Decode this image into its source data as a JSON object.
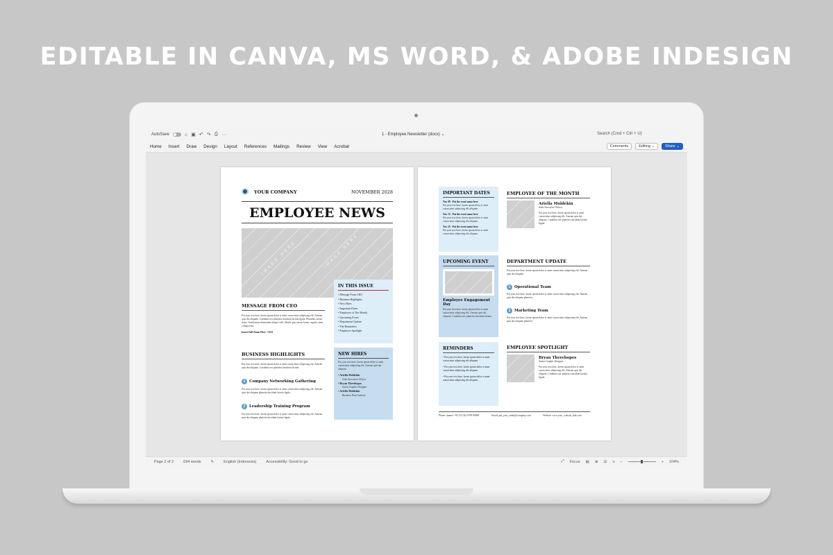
{
  "banner": "EDITABLE IN CANVA, MS WORD, & ADOBE INDESIGN",
  "titlebar": {
    "autosave": "AutoSave",
    "doc_title": "1 - Employee Newsletter (docx) ⌄",
    "search": "Search (Cmd + Ctrl + U)"
  },
  "ribbon": {
    "tabs": [
      "Home",
      "Insert",
      "Draw",
      "Design",
      "Layout",
      "References",
      "Mailings",
      "Review",
      "View",
      "Acrobat"
    ],
    "comments": "Comments",
    "editing": "Editing ⌄",
    "share": "Share ⌄"
  },
  "status": {
    "page": "Page 2 of 2",
    "words": "694 words",
    "language": "English (Indonesia)",
    "accessibility": "Accessibility: Good to go",
    "focus": "Focus",
    "zoom": "104%",
    "minus": "–",
    "plus": "+"
  },
  "page1": {
    "company": "YOUR COMPANY",
    "date": "NOVEMBER 2028",
    "headline": "EMPLOYEE NEWS",
    "image_placeholder": "IMAGE HERE",
    "ceo": {
      "title": "MESSAGE FROM CEO",
      "body": "Put your text here, lorem ipsum dolor si amet consectetur adipiscing elit. Aenean quis dui aliquam. Curabitur nec pharetra tincidunt lacinia ligula. Phasellus lorem dolor. Vestibulum elementum aliquet velit. Morbi quis cursus lorem, sagittis amet volutpat dui.",
      "sign": "Insert Full Name Here - CEO"
    },
    "issue": {
      "title": "IN THIS ISSUE",
      "items": [
        "Message From CEO",
        "Business Highlights",
        "New Hires",
        "Important Dates",
        "Employee of The Month",
        "Upcoming Event",
        "Department Update",
        "The Reminders",
        "Employee Spotlight"
      ]
    },
    "highlights": {
      "title": "BUSINESS HIGHLIGHTS",
      "intro": "Put your text here, lorem ipsum dolor si amet consectetur adipiscing elit. Aenean quis dui aliquam. Curabitur nec pharetra tincidunt lacinia.",
      "items": [
        {
          "num": "1",
          "title": "Company Networking Gathering",
          "body": "Put your text here, lorem ipsum dolor si amet consectetur adipiscing elit. Aenean quis dui aliquam pharetra tincidunt lacinia ligula."
        },
        {
          "num": "2",
          "title": "Leadership Training Program",
          "body": "Put your text here, lorem ipsum dolor si amet consectetur adipiscing elit. Aenean quis dui aliquam pharetra tincidunt lacinia ligula."
        }
      ]
    },
    "hires": {
      "title": "NEW HIRES",
      "body": "Put your text here, lorem ipsum dolor si amet consectetur adipiscing elit. Aenean quis dui aliquam.",
      "people": [
        {
          "name": "Ariella Moldekin",
          "role": "Sales Executive Officer"
        },
        {
          "name": "Bryan Therehopes",
          "role": "Junior Graphic Designer"
        },
        {
          "name": "Ariella Moldekin",
          "role": "Business Data Analysis"
        }
      ]
    }
  },
  "page2": {
    "dates": {
      "title": "IMPORTANT DATES",
      "items": [
        {
          "date": "Nov 08 - Put the event name here",
          "body": "Put your text here, lorem ipsum dolor si amet consectetur adipiscing elit aliquam."
        },
        {
          "date": "Nov 15 - Put the event name here",
          "body": "Put your text here, lorem ipsum dolor si amet consectetur adipiscing elit aliquam."
        },
        {
          "date": "Nov 23 - Put the event name here",
          "body": "Put your text here, lorem ipsum dolor si amet consectetur adipiscing elit aliquam."
        }
      ]
    },
    "event": {
      "title": "UPCOMING EVENT",
      "name": "Employee Engagement Day",
      "body": "Put your text here, lorem ipsum dolor si amet consectetur adipiscing elit. Aenean quis dui aliquam. Curabitur nec pharetra tincidunt lacinia."
    },
    "reminders": {
      "title": "REMINDERS",
      "items": [
        "Put your text here, lorem ipsum dolor si amet consectetur adipiscing elit aliquam.",
        "Put your text here, lorem ipsum dolor si amet consectetur adipiscing elit aliquam.",
        "Put your text here, lorem ipsum dolor si amet consectetur adipiscing elit aliquam."
      ]
    },
    "eom": {
      "title": "EMPLOYEE OF THE MONTH",
      "name": "Ariella Moldekin",
      "role": "Sales Executive Officer",
      "body": "Put your text here, lorem ipsum dolor si amet consectetur adipiscing elit. Aenean quis dui aliquam. Curabitur nec pharetra tincidunt lacinia ligula."
    },
    "dept": {
      "title": "DEPARTMENT UPDATE",
      "intro": "Put your text here, lorem ipsum dolor si amet consectetur adipiscing elit. Aenean quis dui aliquam.",
      "items": [
        {
          "num": "1",
          "title": "Operational Team",
          "body": "Put your text here, lorem ipsum dolor si amet consectetur adipiscing elit. Aenean quis dui aliquam pharetra."
        },
        {
          "num": "2",
          "title": "Marketing Team",
          "body": "Put your text here, lorem ipsum dolor si amet consectetur adipiscing elit. Aenean quis dui aliquam pharetra."
        }
      ]
    },
    "spotlight": {
      "title": "EMPLOYEE SPOTLIGHT",
      "name": "Bryan Therehopes",
      "role": "Senior Graphic Designer",
      "body": "Put your text here, lorem ipsum dolor si amet consectetur adipiscing elit. Aenean quis dui aliquam. Curabitur nec pharetra tincidunt lacinia ligula."
    },
    "footer": {
      "phone": "Phone: (name) +00 123 342 0789 09098",
      "email": "Email: put_your_email@company.com",
      "website": "Website: www.your_website_link.com"
    }
  }
}
